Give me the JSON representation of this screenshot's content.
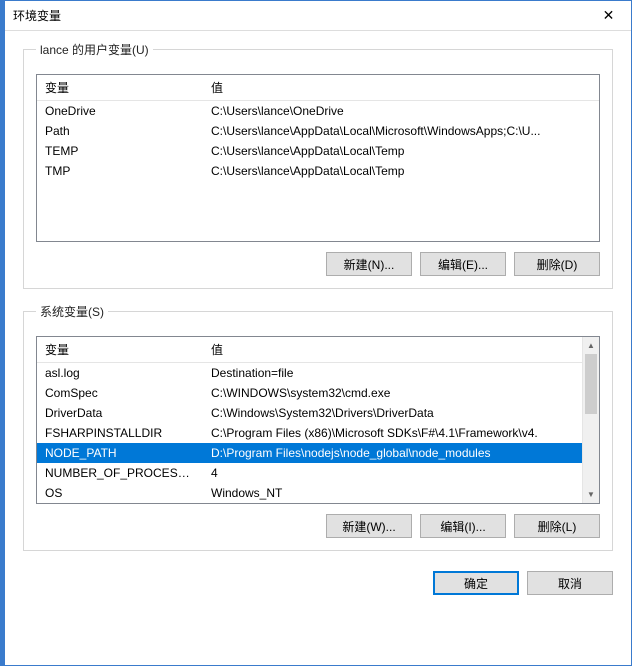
{
  "window": {
    "title": "环境变量"
  },
  "userSection": {
    "legend": "lance 的用户变量(U)",
    "columns": {
      "name": "变量",
      "value": "值"
    },
    "rows": [
      {
        "name": "OneDrive",
        "value": "C:\\Users\\lance\\OneDrive",
        "selected": false
      },
      {
        "name": "Path",
        "value": "C:\\Users\\lance\\AppData\\Local\\Microsoft\\WindowsApps;C:\\U...",
        "selected": false
      },
      {
        "name": "TEMP",
        "value": "C:\\Users\\lance\\AppData\\Local\\Temp",
        "selected": false
      },
      {
        "name": "TMP",
        "value": "C:\\Users\\lance\\AppData\\Local\\Temp",
        "selected": false
      }
    ],
    "buttons": {
      "new": "新建(N)...",
      "edit": "编辑(E)...",
      "delete": "删除(D)"
    }
  },
  "systemSection": {
    "legend": "系统变量(S)",
    "columns": {
      "name": "变量",
      "value": "值"
    },
    "rows": [
      {
        "name": "asl.log",
        "value": "Destination=file",
        "selected": false
      },
      {
        "name": "ComSpec",
        "value": "C:\\WINDOWS\\system32\\cmd.exe",
        "selected": false
      },
      {
        "name": "DriverData",
        "value": "C:\\Windows\\System32\\Drivers\\DriverData",
        "selected": false
      },
      {
        "name": "FSHARPINSTALLDIR",
        "value": "C:\\Program Files (x86)\\Microsoft SDKs\\F#\\4.1\\Framework\\v4.",
        "selected": false
      },
      {
        "name": "NODE_PATH",
        "value": "D:\\Program Files\\nodejs\\node_global\\node_modules",
        "selected": true
      },
      {
        "name": "NUMBER_OF_PROCESSORS",
        "value": "4",
        "selected": false
      },
      {
        "name": "OS",
        "value": "Windows_NT",
        "selected": false
      }
    ],
    "buttons": {
      "new": "新建(W)...",
      "edit": "编辑(I)...",
      "delete": "删除(L)"
    }
  },
  "footer": {
    "ok": "确定",
    "cancel": "取消"
  }
}
